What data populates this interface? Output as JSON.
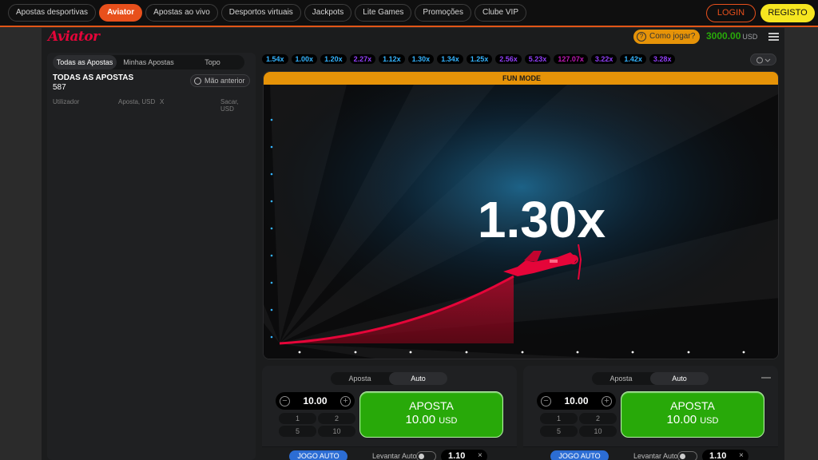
{
  "topnav": {
    "items": [
      "Apostas desportivas",
      "Aviator",
      "Apostas ao vivo",
      "Desportos virtuais",
      "Jackpots",
      "Lite Games",
      "Promoções",
      "Clube VIP"
    ],
    "active": "Aviator",
    "login": "LOGIN",
    "register": "REGISTO"
  },
  "header": {
    "logo": "Aviator",
    "how_to_play": "Como jogar?",
    "balance": "3000.00",
    "currency": "USD"
  },
  "bets_panel": {
    "tabs": [
      "Todas as Apostas",
      "Minhas Apostas",
      "Topo"
    ],
    "title": "TODAS AS APOSTAS",
    "count": "587",
    "prev_hand": "Mão anterior",
    "columns": [
      "Utilizador",
      "Aposta, USD",
      "X",
      "Sacar, USD"
    ]
  },
  "history": [
    {
      "v": "1.54x",
      "c": "blue"
    },
    {
      "v": "1.00x",
      "c": "blue"
    },
    {
      "v": "1.20x",
      "c": "blue"
    },
    {
      "v": "2.27x",
      "c": "purple"
    },
    {
      "v": "1.12x",
      "c": "blue"
    },
    {
      "v": "1.30x",
      "c": "blue"
    },
    {
      "v": "1.34x",
      "c": "blue"
    },
    {
      "v": "1.25x",
      "c": "blue"
    },
    {
      "v": "2.56x",
      "c": "purple"
    },
    {
      "v": "5.23x",
      "c": "purple"
    },
    {
      "v": "127.07x",
      "c": "pink"
    },
    {
      "v": "3.22x",
      "c": "purple"
    },
    {
      "v": "1.42x",
      "c": "blue"
    },
    {
      "v": "3.28x",
      "c": "purple"
    }
  ],
  "play": {
    "fun_mode": "FUN MODE",
    "multiplier": "1.30x"
  },
  "bet_panels": [
    {
      "tabs": [
        "Aposta",
        "Auto"
      ],
      "active_tab": "Auto",
      "amount": "10.00",
      "quick": [
        "1",
        "2",
        "5",
        "10"
      ],
      "bet_label": "APOSTA",
      "bet_amount": "10.00",
      "bet_currency": "USD",
      "auto_game": "JOGO AUTO",
      "auto_cashout": "Levantar Auto",
      "cashout_value": "1.10"
    },
    {
      "tabs": [
        "Aposta",
        "Auto"
      ],
      "active_tab": "Auto",
      "amount": "10.00",
      "quick": [
        "1",
        "2",
        "5",
        "10"
      ],
      "bet_label": "APOSTA",
      "bet_amount": "10.00",
      "bet_currency": "USD",
      "auto_game": "JOGO AUTO",
      "auto_cashout": "Levantar Auto",
      "cashout_value": "1.10"
    }
  ],
  "colors": {
    "accent": "#e8501c",
    "register": "#f6e620",
    "green": "#28a909",
    "fun_mode": "#e69308",
    "plane_red": "#e50539",
    "blue_mult": "#34b4ff",
    "purple_mult": "#913ef8",
    "pink_mult": "#c017b4"
  },
  "icons": [
    "menu-icon",
    "history-icon",
    "clock-icon",
    "plane-icon",
    "question-icon"
  ]
}
